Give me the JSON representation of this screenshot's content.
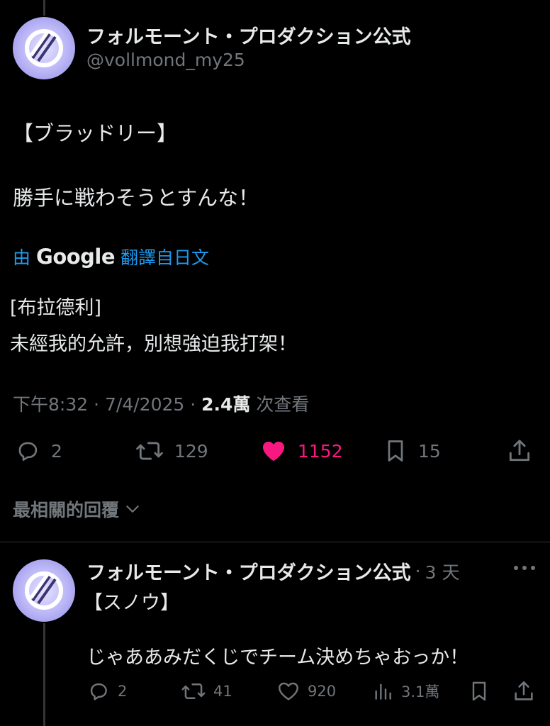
{
  "tweet": {
    "author_name": "フォルモーント・プロダクション公式",
    "handle": "@vollmond_my25",
    "line1": "【ブラッドリー】",
    "line2": "勝手に戦わそうとすんな！",
    "translate_prefix": "由",
    "translate_brand": "Google",
    "translate_suffix": "翻譯自日文",
    "translated_line1": "[布拉德利]",
    "translated_line2": "未經我的允許，別想強迫我打架！",
    "time": "下午8:32",
    "date": "7/4/2025",
    "views": "2.4萬",
    "views_label": "次查看",
    "dot": "·",
    "replies": "2",
    "retweets": "129",
    "likes": "1152",
    "bookmarks": "15"
  },
  "section": {
    "sort_label": "最相關的回覆"
  },
  "reply": {
    "author_name": "フォルモーント・プロダクション公式",
    "dot": "·",
    "time_ago": "3 天",
    "line1": "【スノウ】",
    "line2": "じゃああみだくじでチーム決めちゃおっか！",
    "replies": "2",
    "retweets": "41",
    "likes": "920",
    "views": "3.1萬"
  },
  "colors": {
    "background": "#000000",
    "text": "#e7e9ea",
    "muted": "#71767b",
    "link": "#1d9bf0",
    "like": "#f91880"
  },
  "icons": [
    "reply-icon",
    "retweet-icon",
    "heart-icon",
    "bookmark-icon",
    "share-icon",
    "views-icon",
    "more-icon",
    "chevron-down-icon"
  ]
}
